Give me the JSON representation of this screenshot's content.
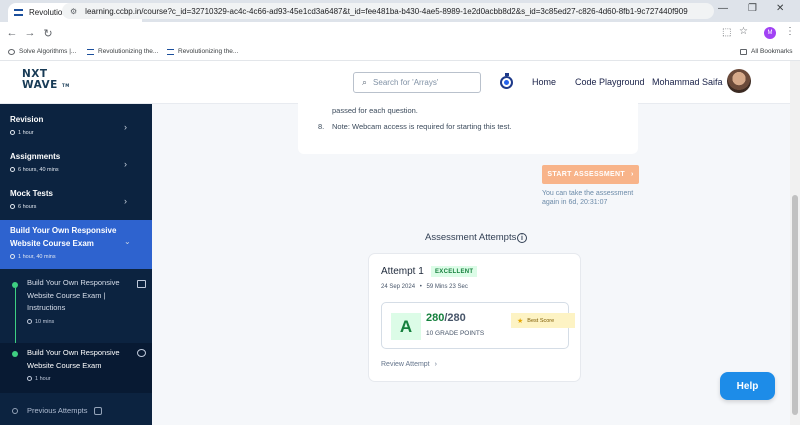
{
  "browser": {
    "tab_title": "Revolutionizing the Job Market",
    "tab_close": "×",
    "new_tab": "+",
    "url": "learning.ccbp.in/course?c_id=32710329-ac4c-4c66-ad93-45e1cd3a6487&t_id=fee481ba-b430-4ae5-8989-1e2d0acbb8d2&s_id=3c85ed27-c826-4d60-8fb1-9c727440f909",
    "profile_initial": "M",
    "bookmarks": [
      "Solve Algorithms |...",
      "Revolutionizing the...",
      "Revolutionizing the..."
    ],
    "all_bookmarks": "All Bookmarks"
  },
  "header": {
    "logo_line1": "NXT",
    "logo_line2": "WAVE",
    "logo_tm": "TM",
    "search_placeholder": "Search for 'Arrays'",
    "nav_home": "Home",
    "nav_playground": "Code Playground",
    "user_name": "Mohammad Saifa"
  },
  "sidebar": {
    "items": [
      {
        "title": "Revision",
        "duration": "1 hour"
      },
      {
        "title": "Assignments",
        "duration": "6 hours, 40 mins"
      },
      {
        "title": "Mock Tests",
        "duration": "6 hours"
      }
    ],
    "active": {
      "title_line1": "Build Your Own Responsive",
      "title_line2": "Website Course Exam",
      "duration": "1 hour, 40 mins"
    },
    "subitems": [
      {
        "line1": "Build Your Own Responsive",
        "line2": "Website Course Exam |",
        "line3": "Instructions",
        "duration": "10 mins"
      },
      {
        "line1": "Build Your Own Responsive",
        "line2": "Website Course Exam",
        "duration": "1 hour"
      }
    ],
    "previous_attempts": "Previous Attempts"
  },
  "instructions": {
    "line_continued": "passed for each question.",
    "item8_num": "8.",
    "item8_text": "Note: Webcam access is required for starting this test."
  },
  "assessment": {
    "start_button": "START ASSESSMENT",
    "retake_line1": "You can take the assessment",
    "retake_line2": "again in 6d, 20:31:07",
    "attempts_title": "Assessment Attempts",
    "attempt": {
      "name": "Attempt 1",
      "badge": "EXCELLENT",
      "date": "24 Sep 2024",
      "duration": "59 Mins 23 Sec",
      "grade": "A",
      "score": "280",
      "total": "/280",
      "grade_points": "10 GRADE POINTS",
      "best_score": "Best Score",
      "review": "Review Attempt"
    }
  },
  "help_button": "Help"
}
